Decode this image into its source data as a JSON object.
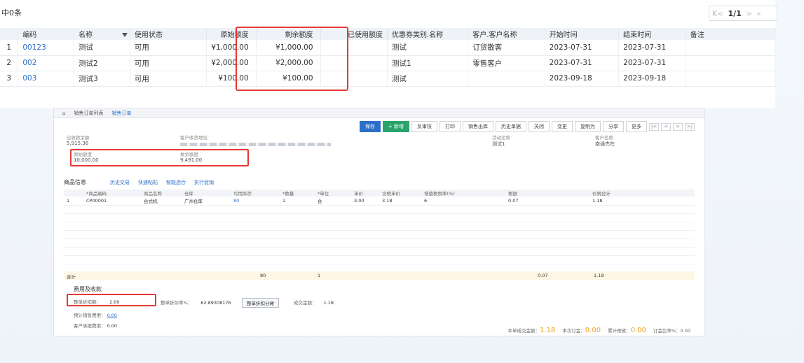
{
  "top": {
    "count_label": "中0条",
    "pager": {
      "first": "K<",
      "page": "1/1",
      "next": ">",
      "last": "»"
    },
    "columns": [
      "",
      "编码",
      "名称",
      "使用状态",
      "原始额度",
      "剩余额度",
      "已使用额度",
      "优惠券类别.名称",
      "客户.客户名称",
      "开始时间",
      "结束时间",
      "备注"
    ],
    "rows": [
      {
        "idx": "1",
        "code": "00123",
        "name": "测试",
        "status": "可用",
        "orig": "¥1,000.00",
        "remain": "¥1,000.00",
        "used": "",
        "cat": "测试",
        "cust": "订货散客",
        "start": "2023-07-31",
        "end": "2023-07-31",
        "note": ""
      },
      {
        "idx": "2",
        "code": "002",
        "name": "测试2",
        "status": "可用",
        "orig": "¥2,000.00",
        "remain": "¥2,000.00",
        "used": "",
        "cat": "测试1",
        "cust": "零售客户",
        "start": "2023-07-31",
        "end": "2023-07-31",
        "note": ""
      },
      {
        "idx": "3",
        "code": "003",
        "name": "测试3",
        "status": "可用",
        "orig": "¥100.00",
        "remain": "¥100.00",
        "used": "",
        "cat": "测试",
        "cust": "",
        "start": "2023-09-18",
        "end": "2023-09-18",
        "note": ""
      }
    ]
  },
  "order": {
    "tabs": [
      "销售订单列表",
      "销售订单"
    ],
    "toolbar": [
      "保存",
      "+ 新增",
      "反审核",
      "打印",
      "销售出库",
      "历史单据",
      "关闭",
      "变更",
      "复制为",
      "分享",
      "更多"
    ],
    "info": {
      "recv_label": "应收款余额",
      "recv_value": "5,915.36",
      "addr_label": "客户收货地址",
      "activity_label": "活动名称",
      "activity_value": "测试1",
      "cust_label": "客户名称",
      "cust_value": "南通杰在",
      "orig_label": "原始额度",
      "orig_value": "10,000.00",
      "remain_label": "剩余额度",
      "remain_value": "9,491.00"
    },
    "goods_title": "商品信息",
    "goods_links": [
      "历史交易",
      "快速粘贴",
      "智能选仓",
      "执行促销"
    ],
    "grid_headers": [
      "*商品编码",
      "商品名称",
      "仓库",
      "可用库存",
      "*数量",
      "*单位",
      "单价",
      "含税单价",
      "增值税税率(%)",
      "税额",
      "价税合计"
    ],
    "grid_row": {
      "idx": "1",
      "code": "CP00001",
      "name": "台式机",
      "wh": "广州仓库",
      "stock": "80",
      "qty": "1",
      "unit": "台",
      "price": "3.00",
      "taxprice": "3.18",
      "rate": "6",
      "tax": "0.07",
      "total": "1.18"
    },
    "sum": {
      "label": "合计",
      "stock": "80",
      "qty": "1",
      "tax": "0.07",
      "total": "1.18"
    },
    "fee_title": "费用及收款",
    "discount_label": "整单折扣额：",
    "discount_value": "2.00",
    "rate_label": "整单折扣率%：",
    "rate_value": "62.89308176",
    "split_btn": "整单折扣分摊",
    "deal_label": "成交金额：",
    "deal_value": "1.18",
    "pre_label": "预计销售费用：",
    "pre_value": "0.00",
    "cust_fee_label": "客户承担费用：",
    "cust_fee_value": "0.00",
    "bottom": {
      "deal_label": "本单成交金额：",
      "deal_value": "1.18",
      "order_label": "本次订金：",
      "order_value": "0.00",
      "pay_label": "累计预收：",
      "pay_value": "0.00",
      "rate_label": "订金比率%：",
      "rate_value": "0.00"
    }
  }
}
